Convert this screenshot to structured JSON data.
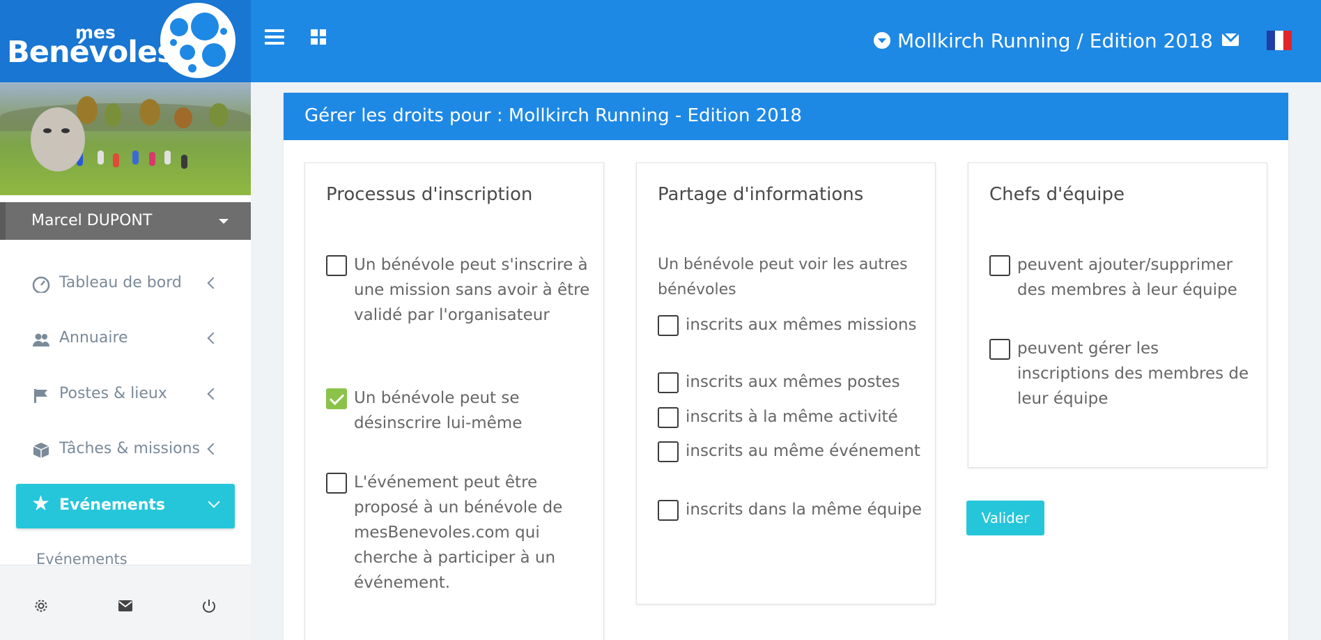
{
  "brand": {
    "prefix": "mes",
    "name": "Benévoles"
  },
  "topbar": {
    "event_selector": "Mollkirch Running / Edition 2018",
    "colors": {
      "bar": "#1e88e5",
      "brand_bg": "#1976d2"
    },
    "flag_colors": [
      "#1f3ea6",
      "#ffffff",
      "#e0242b"
    ]
  },
  "sidebar": {
    "user_name": "Marcel DUPONT",
    "menu": [
      {
        "label": "Tableau de bord",
        "icon": "dashboard-icon"
      },
      {
        "label": "Annuaire",
        "icon": "users-icon"
      },
      {
        "label": "Postes & lieux",
        "icon": "flag-icon"
      },
      {
        "label": "Tâches & missions",
        "icon": "cube-icon"
      }
    ],
    "active": {
      "label": "Evénements",
      "icon": "star-icon"
    },
    "submenu": "Evénements",
    "footer_icons": [
      "settings-icon",
      "mail-icon",
      "power-icon"
    ]
  },
  "main": {
    "title": "Gérer les droits pour : Mollkirch Running - Edition 2018",
    "panels": [
      {
        "title": "Processus d'inscription",
        "options": [
          {
            "text": "Un bénévole peut s'inscrire à une mission sans avoir à être validé par l'organisateur",
            "checked": false
          },
          {
            "text": "Un bénévole peut se désinscrire lui-même",
            "checked": true
          },
          {
            "text": "L'événement peut être proposé à un bénévole de mesBenevoles.com qui cherche à participer à un événement.",
            "checked": false
          }
        ]
      },
      {
        "title": "Partage d'informations",
        "intro": "Un bénévole peut voir les autres bénévoles",
        "options": [
          {
            "text": "inscrits aux mêmes missions",
            "checked": false
          },
          {
            "text": "inscrits aux mêmes postes",
            "checked": false
          },
          {
            "text": "inscrits à la même activité",
            "checked": false
          },
          {
            "text": "inscrits au même événement",
            "checked": false
          },
          {
            "text": "inscrits dans la même équipe",
            "checked": false
          }
        ]
      },
      {
        "title": "Chefs d'équipe",
        "options": [
          {
            "text": "peuvent ajouter/supprimer des membres à leur équipe",
            "checked": false
          },
          {
            "text": "peuvent gérer les inscriptions des membres de leur équipe",
            "checked": false
          }
        ]
      }
    ],
    "submit_label": "Valider",
    "accent": "#26c6da",
    "check_color": "#8bc34a"
  }
}
